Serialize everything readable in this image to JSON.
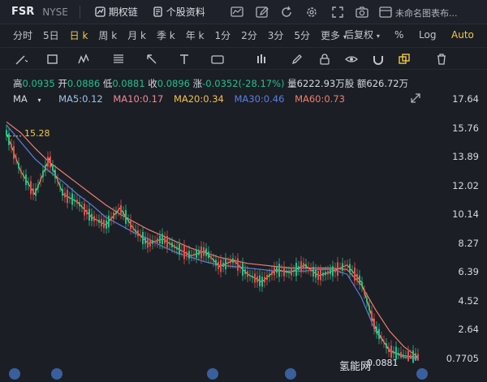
{
  "header": {
    "symbol": "FSR",
    "exchange": "NYSE",
    "options_chain": "期权链",
    "stock_profile": "个股资料",
    "doc_name": "未命名图表布..."
  },
  "periods": [
    "分时",
    "5日",
    "日 k",
    "周 k",
    "月 k",
    "季 k",
    "年 k",
    "1分",
    "2分",
    "3分",
    "5分",
    "更多"
  ],
  "active_period": "日 k",
  "period_right": {
    "adjust": "后复权",
    "percent": "%",
    "log": "Log",
    "auto": "Auto"
  },
  "quote": {
    "high_label": "高",
    "high": "0.0935",
    "open_label": "开",
    "open": "0.0886",
    "low_label": "低",
    "low": "0.0881",
    "close_label": "收",
    "close": "0.0896",
    "change_label": "涨",
    "change": "-0.0352(-28.17%)",
    "volume_label": "量",
    "volume": "6222.93万股",
    "amount_label": "额",
    "amount": "626.72万"
  },
  "ma": {
    "label": "MA",
    "ma5": "MA5:0.12",
    "ma10": "MA10:0.17",
    "ma20": "MA20:0.34",
    "ma30": "MA30:0.46",
    "ma60": "MA60:0.73"
  },
  "colors": {
    "up": "#e0504f",
    "down": "#23c08b",
    "ma5": "#9fc3e8",
    "ma10": "#f08a96",
    "ma20": "#f2c14b",
    "ma30": "#5a7fe0",
    "ma60": "#f07e6e"
  },
  "chart_data": {
    "type": "line",
    "title": "",
    "y_ticks": [
      "17.64",
      "15.76",
      "13.89",
      "12.02",
      "10.14",
      "8.27",
      "6.39",
      "4.52",
      "2.64",
      "0.7705"
    ],
    "ylim": [
      0.7705,
      17.64
    ],
    "high_marker": "15.28",
    "last_price": "0.0881",
    "watermark": "氢能网",
    "series": [
      {
        "name": "MA30",
        "values": [
          16.0,
          14.9,
          13.8,
          13.0,
          12.3,
          11.5,
          10.8,
          10.0,
          9.5,
          9.0,
          8.6,
          8.1,
          7.7,
          7.4,
          7.1,
          6.9,
          6.8,
          6.7,
          6.6,
          6.5,
          6.5,
          6.5,
          6.6,
          6.6,
          6.3,
          4.8,
          2.6,
          1.4,
          0.9,
          0.8
        ]
      },
      {
        "name": "MA60",
        "values": [
          16.2,
          15.5,
          14.5,
          13.6,
          12.9,
          12.2,
          11.5,
          10.8,
          10.2,
          9.7,
          9.2,
          8.8,
          8.4,
          8.0,
          7.7,
          7.4,
          7.2,
          7.0,
          6.9,
          6.8,
          6.7,
          6.7,
          6.7,
          6.7,
          6.6,
          5.6,
          4.0,
          2.6,
          1.6,
          0.9
        ]
      },
      {
        "name": "Close",
        "values": [
          15.5,
          13.0,
          11.5,
          13.8,
          11.5,
          11.0,
          10.0,
          9.5,
          10.6,
          9.2,
          8.3,
          8.6,
          8.0,
          7.5,
          7.8,
          6.8,
          7.2,
          6.3,
          5.8,
          6.6,
          6.4,
          6.9,
          6.2,
          6.5,
          6.9,
          5.8,
          2.8,
          1.3,
          1.0,
          0.9
        ]
      }
    ]
  }
}
